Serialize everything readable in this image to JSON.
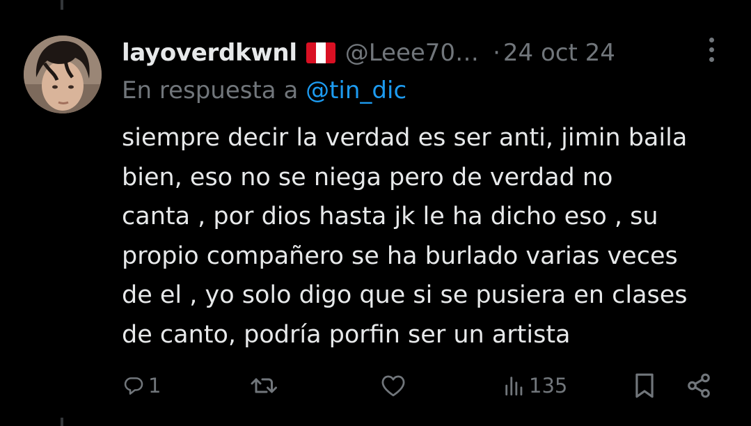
{
  "theme": {
    "background": "#000000",
    "text_primary": "#e7e9ea",
    "text_secondary": "#71767b",
    "link": "#1d9bf0"
  },
  "tweet": {
    "author": {
      "display_name": "layoverdkwnl",
      "flag_icon": "peru-flag-icon",
      "handle": "@Leee70…"
    },
    "separator": "·",
    "date": "24 oct 24",
    "reply_prefix": "En respuesta a ",
    "reply_mention": "@tin_dic",
    "text_lines": [
      "siempre decir la verdad es ser anti, jimin baila",
      "bien, eso no se niega pero de verdad no",
      "canta , por dios hasta jk le ha dicho eso , su",
      "propio compañero se ha burlado varias veces",
      "de el , yo solo digo que si se pusiera en clases",
      "de canto, podría porfin ser un artista"
    ],
    "actions": {
      "reply": {
        "icon": "reply-icon",
        "count": "1"
      },
      "retweet": {
        "icon": "retweet-icon",
        "count": ""
      },
      "like": {
        "icon": "heart-icon",
        "count": ""
      },
      "views": {
        "icon": "views-icon",
        "count": "135"
      },
      "bookmark": {
        "icon": "bookmark-icon"
      },
      "share": {
        "icon": "share-icon"
      }
    }
  }
}
